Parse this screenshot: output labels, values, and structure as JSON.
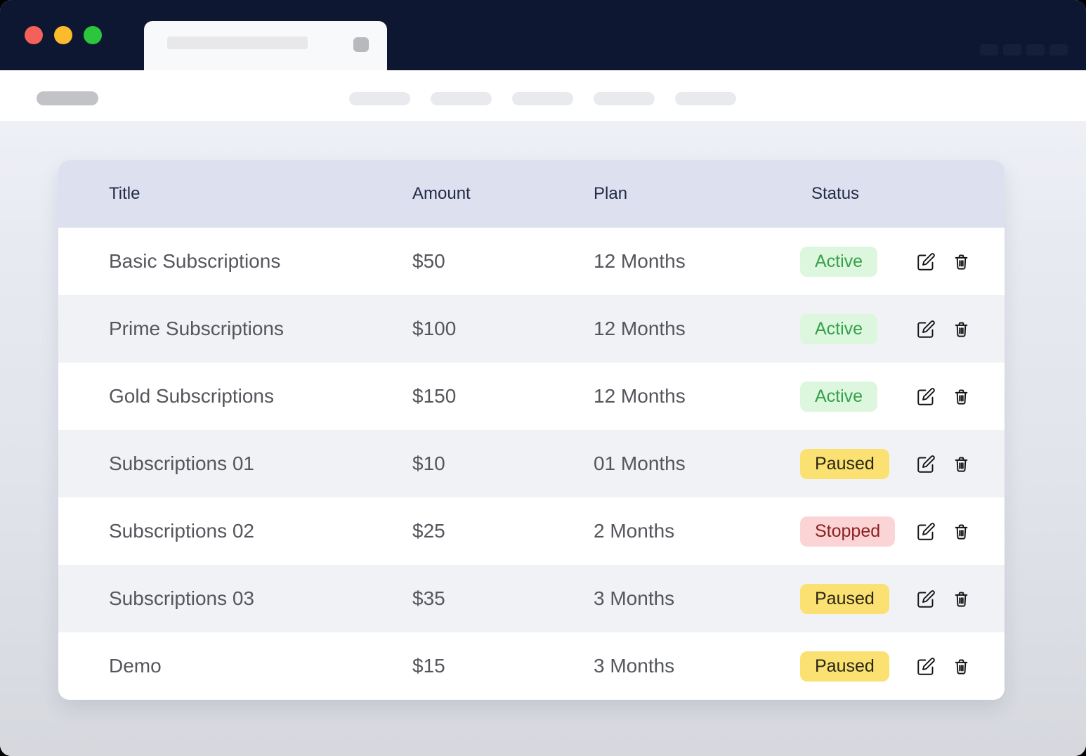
{
  "window": {
    "controls": [
      "close",
      "minimize",
      "zoom"
    ]
  },
  "table": {
    "columns": [
      "Title",
      "Amount",
      "Plan",
      "Status"
    ],
    "rows": [
      {
        "title": "Basic Subscriptions",
        "amount": "$50",
        "plan": "12 Months",
        "status": "Active"
      },
      {
        "title": "Prime Subscriptions",
        "amount": "$100",
        "plan": "12 Months",
        "status": "Active"
      },
      {
        "title": "Gold Subscriptions",
        "amount": "$150",
        "plan": "12 Months",
        "status": "Active"
      },
      {
        "title": "Subscriptions 01",
        "amount": "$10",
        "plan": "01 Months",
        "status": "Paused"
      },
      {
        "title": "Subscriptions 02",
        "amount": "$25",
        "plan": "2 Months",
        "status": "Stopped"
      },
      {
        "title": "Subscriptions 03",
        "amount": "$35",
        "plan": "3 Months",
        "status": "Paused"
      },
      {
        "title": "Demo",
        "amount": "$15",
        "plan": "3 Months",
        "status": "Paused"
      }
    ],
    "status_colors": {
      "Active": {
        "bg": "#dcf7dd",
        "fg": "#36a14b"
      },
      "Paused": {
        "bg": "#fae171",
        "fg": "#2a2717"
      },
      "Stopped": {
        "bg": "#fbd4d6",
        "fg": "#8e2021"
      }
    },
    "row_actions": [
      "edit",
      "delete"
    ]
  },
  "icons": {
    "edit": "pencil-square",
    "delete": "trash-can"
  },
  "colors": {
    "chrome_bar": "#0d1731",
    "header_row": "#dde0ef",
    "alt_row": "#f1f2f5",
    "content_bg_top": "#eef0f6",
    "content_bg_bottom": "#d6d8de"
  }
}
